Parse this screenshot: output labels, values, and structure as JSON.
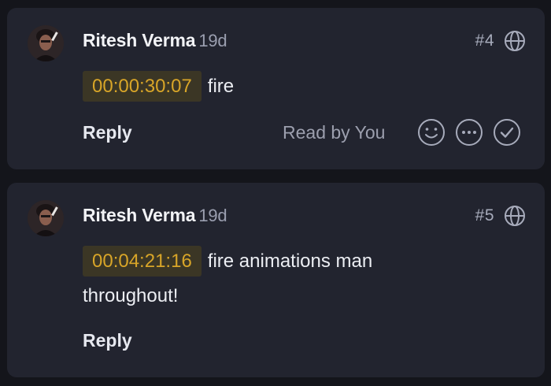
{
  "comments": [
    {
      "author": "Ritesh Verma",
      "age": "19d",
      "number": "#4",
      "timecode": "00:00:30:07",
      "text": "fire",
      "reply_label": "Reply",
      "read_status": "Read by You",
      "icons": [
        "avatar",
        "globe-icon",
        "emoji-icon",
        "more-icon",
        "check-icon"
      ]
    },
    {
      "author": "Ritesh Verma",
      "age": "19d",
      "number": "#5",
      "timecode": "00:04:21:16",
      "text": "fire animations man throughout!",
      "reply_label": "Reply",
      "icons": [
        "avatar",
        "globe-icon"
      ]
    }
  ],
  "colors": {
    "background": "#14151b",
    "card": "#22242f",
    "timecode_text": "#d8a528",
    "timecode_bg": "#3b3625"
  }
}
